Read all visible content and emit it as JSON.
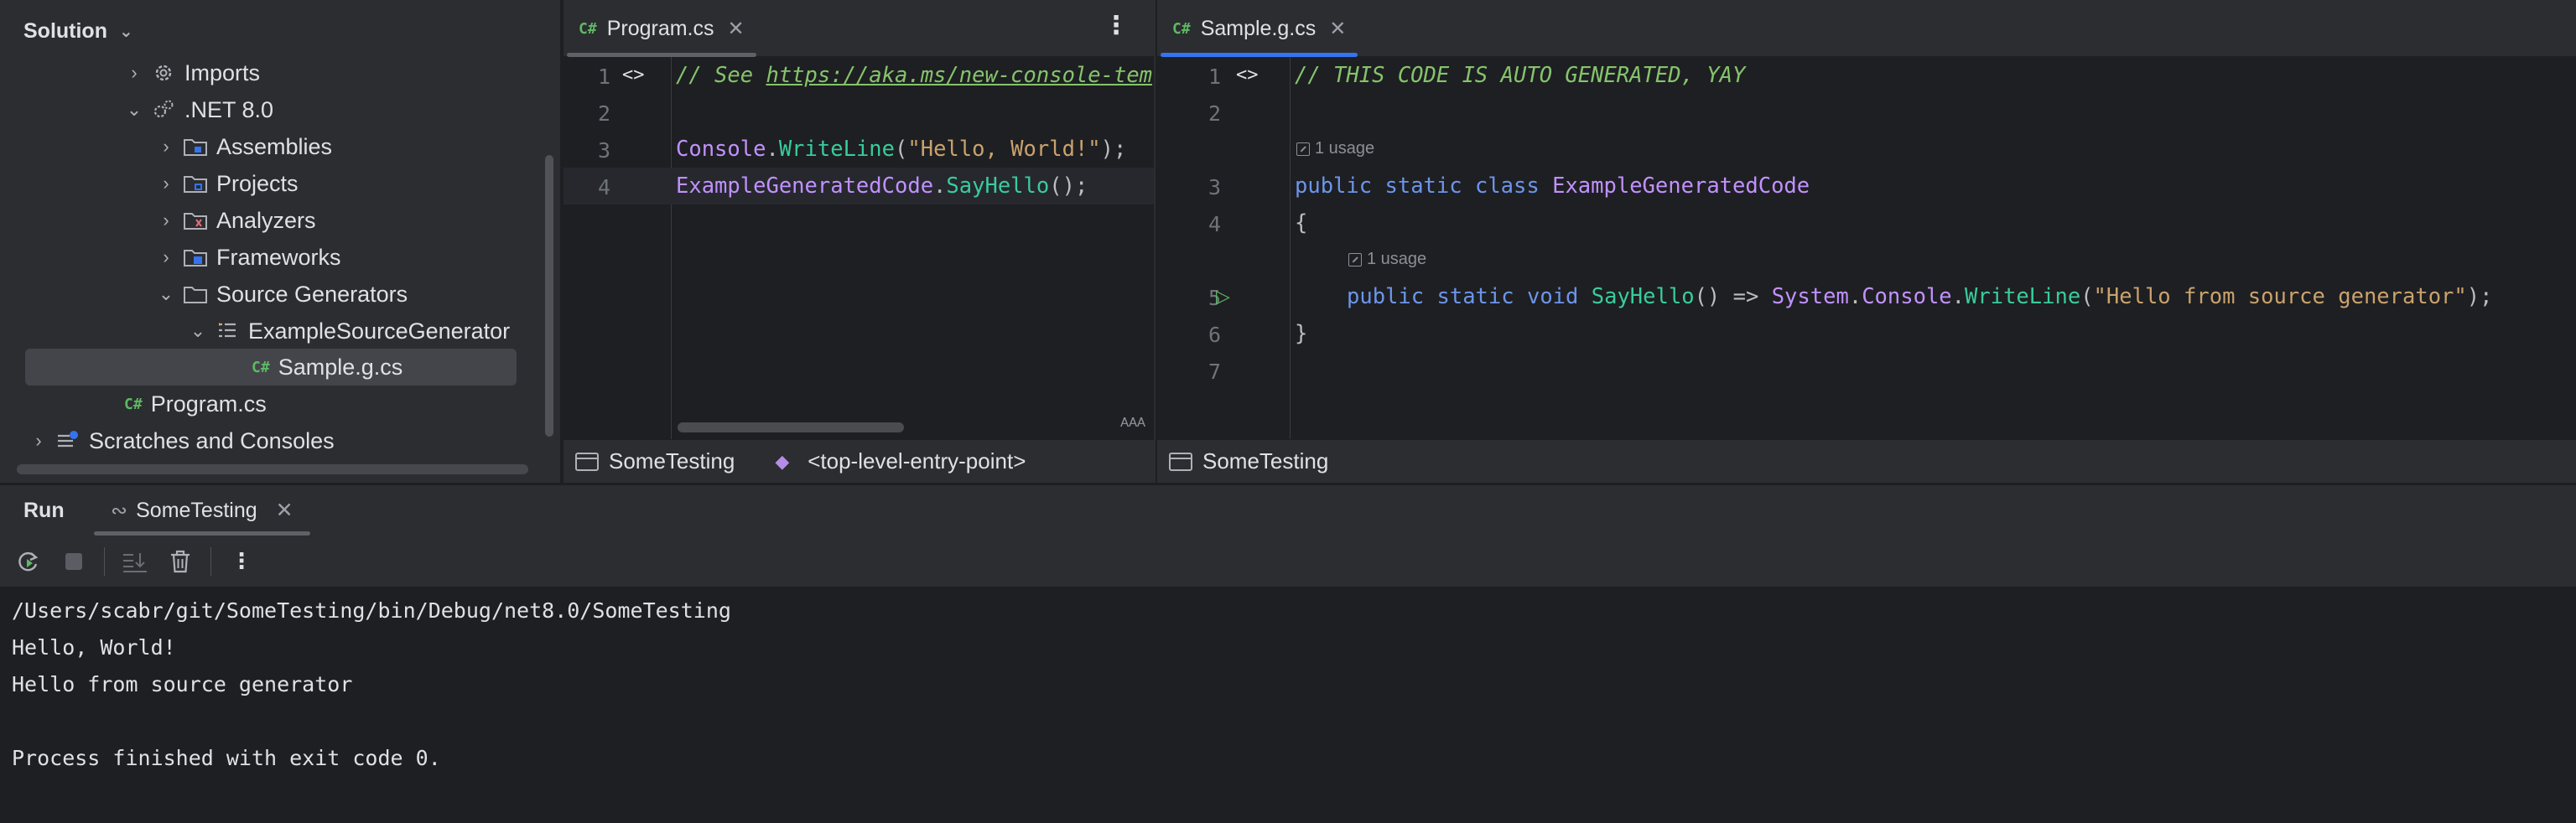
{
  "solution": {
    "title": "Solution",
    "items": [
      {
        "label": "Imports"
      },
      {
        "label": ".NET 8.0"
      },
      {
        "label": "Assemblies"
      },
      {
        "label": "Projects"
      },
      {
        "label": "Analyzers"
      },
      {
        "label": "Frameworks"
      },
      {
        "label": "Source Generators"
      },
      {
        "label": "ExampleSourceGenerator"
      },
      {
        "label": "Sample.g.cs",
        "badge": "C#"
      },
      {
        "label": "Program.cs",
        "badge": "C#"
      },
      {
        "label": "Scratches and Consoles"
      }
    ]
  },
  "editor1": {
    "tab": {
      "badge": "C#",
      "label": "Program.cs",
      "close": "✕"
    },
    "kebab": "⋮",
    "line_numbers": [
      "1",
      "2",
      "3",
      "4"
    ],
    "lines": {
      "l1_comment": "// See ",
      "l1_link": "https://aka.ms/new-console-tem",
      "l3_class": "Console",
      "l3_dot": ".",
      "l3_method": "WriteLine",
      "l3_open": "(",
      "l3_string": "\"Hello, World!\"",
      "l3_close": ");",
      "l4_class": "ExampleGeneratedCode",
      "l4_dot": ".",
      "l4_method": "SayHello",
      "l4_close": "();"
    },
    "breadcrumb": {
      "project": "SomeTesting",
      "member": "<top-level-entry-point>"
    }
  },
  "editor2": {
    "tab": {
      "badge": "C#",
      "label": "Sample.g.cs",
      "close": "✕"
    },
    "line_numbers": [
      "1",
      "2",
      "3",
      "4",
      "5",
      "6",
      "7"
    ],
    "usage_hint": "1 usage",
    "lines": {
      "l1_comment": "// THIS CODE IS AUTO GENERATED, YAY",
      "l3_kw1": "public",
      "l3_kw2": "static",
      "l3_kw3": "class",
      "l3_type": "ExampleGeneratedCode",
      "l4_brace": "{",
      "l5_kw1": "public",
      "l5_kw2": "static",
      "l5_kw3": "void",
      "l5_method": "SayHello",
      "l5_paren": "() =>",
      "l5_ns": "System",
      "l5_dot1": ".",
      "l5_class": "Console",
      "l5_dot2": ".",
      "l5_call": "WriteLine",
      "l5_open": "(",
      "l5_string": "\"Hello from source generator\"",
      "l5_close": ");",
      "l6_brace": "}"
    },
    "breadcrumb": {
      "project": "SomeTesting"
    }
  },
  "run": {
    "title": "Run",
    "tab_label": "SomeTesting",
    "tab_close": "✕",
    "console": [
      "/Users/scabr/git/SomeTesting/bin/Debug/net8.0/SomeTesting",
      "Hello, World!",
      "Hello from source generator",
      "",
      "Process finished with exit code 0."
    ]
  },
  "colors": {
    "background": "#1e1f22",
    "panel": "#2b2d30",
    "accent_tab": "#3574f0",
    "keyword": "#6c95eb",
    "type": "#c191ff",
    "method": "#39cc9b",
    "string": "#c9a26d",
    "comment": "#85c46c"
  }
}
